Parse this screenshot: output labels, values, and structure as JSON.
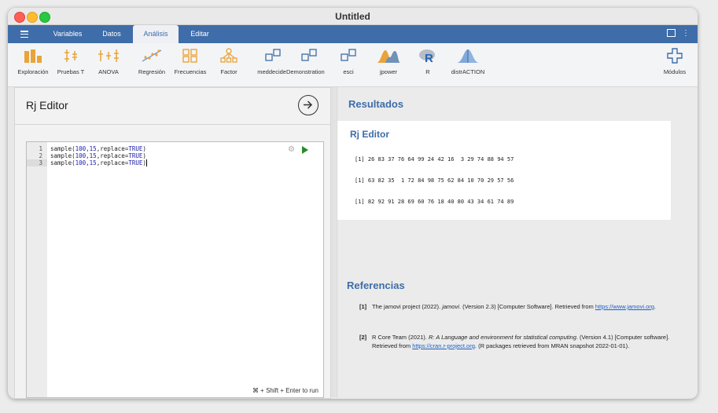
{
  "window": {
    "title": "Untitled"
  },
  "menubar": {
    "tabs": [
      "Variables",
      "Datos",
      "Análisis",
      "Editar"
    ],
    "active_tab": "Análisis"
  },
  "ribbon": {
    "items": [
      "Exploración",
      "Pruebas T",
      "ANOVA",
      "Regresión",
      "Frecuencias",
      "Factor",
      "meddecideDemonstration",
      "esci",
      "jpower",
      "R",
      "distrACTION"
    ],
    "modules": "Módulos"
  },
  "editor": {
    "title": "Rj Editor",
    "lines": [
      {
        "n": "1",
        "pre": "sample(",
        "a": "100",
        "b": "15",
        "mid": ",replace=",
        "kw": "TRUE",
        "post": ")"
      },
      {
        "n": "2",
        "pre": "sample(",
        "a": "100",
        "b": "15",
        "mid": ",replace=",
        "kw": "TRUE",
        "post": ")"
      },
      {
        "n": "3",
        "pre": "sample(",
        "a": "100",
        "b": "15",
        "mid": ",replace=",
        "kw": "TRUE",
        "post": ")"
      }
    ],
    "run_hint": "⌘ + Shift + Enter to run"
  },
  "results": {
    "heading": "Resultados",
    "box_title": "Rj Editor",
    "outputs": [
      "[1] 26 83 37 76 64 99 24 42 16  3 29 74 88 94 57",
      "[1] 63 82 35  1 72 84 98 75 62 84 10 70 29 57 56",
      "[1] 82 92 91 28 69 60 76 18 40 80 43 34 61 74 89"
    ]
  },
  "references": {
    "heading": "Referencias",
    "items": [
      {
        "num": "[1]",
        "before": "The jamovi project (2022). ",
        "italic": "jamovi",
        "after": ". (Version 2.3) [Computer Software]. Retrieved from ",
        "link": "https://www.jamovi.org",
        "end": "."
      },
      {
        "num": "[2]",
        "before": "R Core Team (2021). ",
        "italic": "R: A Language and environment for statistical computing",
        "after": ". (Version 4.1) [Computer software]. Retrieved from ",
        "link": "https://cran.r-project.org",
        "end": ". (R packages retrieved from MRAN snapshot 2022-01-01)."
      }
    ]
  },
  "colors": {
    "accent": "#3e6da9",
    "heading": "#3e6da9",
    "run": "#2a8a2a"
  }
}
